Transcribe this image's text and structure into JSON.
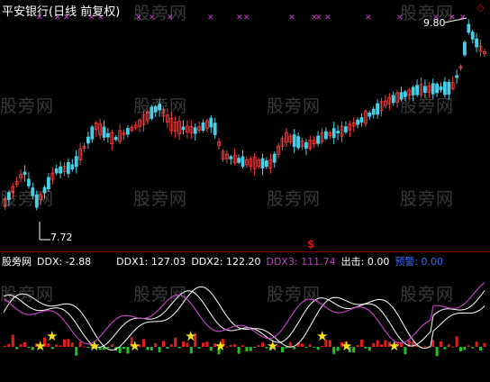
{
  "title": "平安银行(日线 前复权)",
  "price_pane": {
    "max_label": "9.80",
    "min_label": "7.72",
    "signal_glyph": "$",
    "corner_glyph": "◇"
  },
  "ddx_header": {
    "indicator_name": "股旁网",
    "ddx": "DDX: -2.88",
    "ddx1": "DDX1: 127.03",
    "ddx2": "DDX2: 122.20",
    "ddx3": "DDX3: 111.74",
    "exit": "出击: 0.00",
    "warn": "预警: 0.00"
  },
  "watermark_text": "股旁网",
  "colors": {
    "up": "#ff3b3b",
    "down": "#46d0e8",
    "ddx1": "#ffffff",
    "ddx2": "#ffffff",
    "ddx3": "#c040c0",
    "marker": "#d040d0",
    "star": "#f2e21a",
    "green_bar": "#22c022",
    "red_bar": "#e02020"
  }
}
